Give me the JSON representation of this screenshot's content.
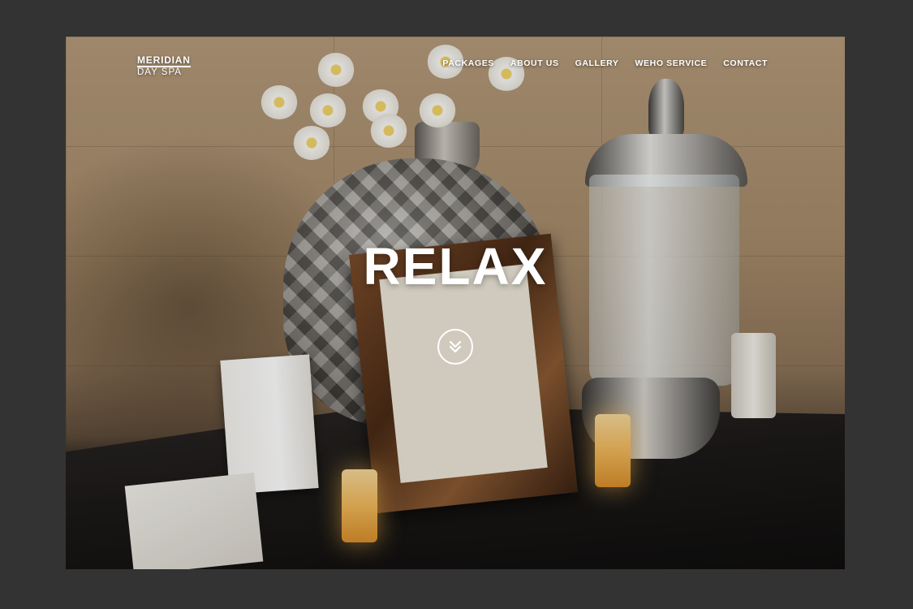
{
  "brand": {
    "name": "MERIDIAN",
    "subtitle": "DAY SPA"
  },
  "nav": {
    "items": [
      {
        "label": "PACKAGES"
      },
      {
        "label": "ABOUT US"
      },
      {
        "label": "GALLERY"
      },
      {
        "label": "WEHO SERVICE"
      },
      {
        "label": "CONTACT"
      }
    ]
  },
  "hero": {
    "title": "RELAX",
    "scroll_icon": "double-chevron-down-icon"
  },
  "colors": {
    "page_background": "#333333",
    "text": "#ffffff"
  }
}
